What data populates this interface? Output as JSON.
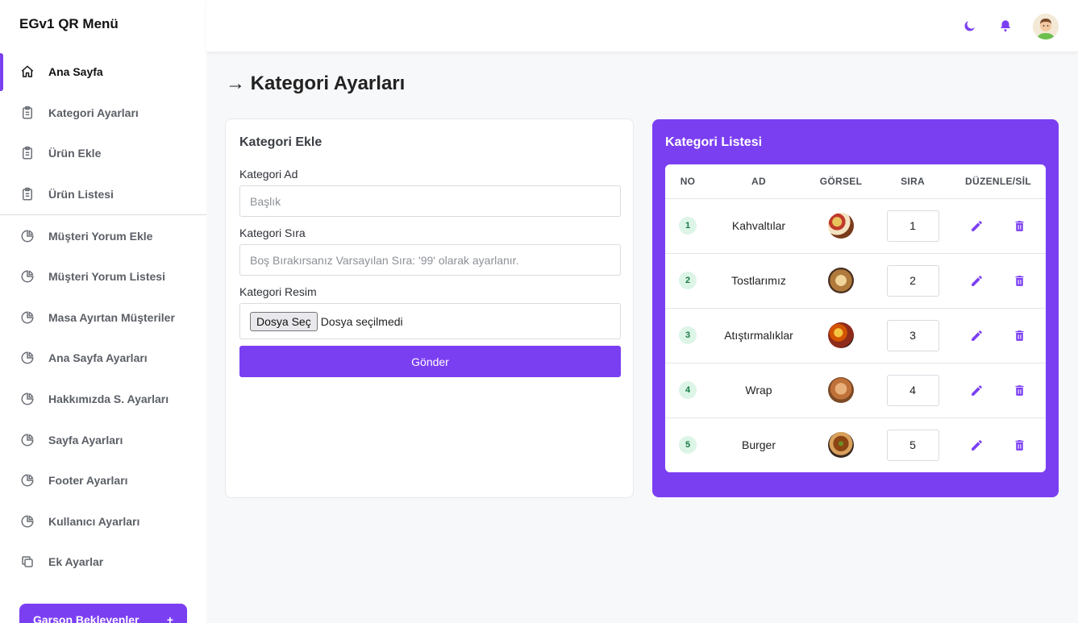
{
  "app": {
    "brand": "EGv1 QR Menü"
  },
  "sidebar": {
    "items": [
      {
        "label": "Ana Sayfa",
        "icon": "home-icon",
        "active": true
      },
      {
        "label": "Kategori Ayarları",
        "icon": "clipboard-icon"
      },
      {
        "label": "Ürün Ekle",
        "icon": "clipboard-icon"
      },
      {
        "label": "Ürün Listesi",
        "icon": "clipboard-icon"
      },
      {
        "label": "Müşteri Yorum Ekle",
        "icon": "pie-chart-icon"
      },
      {
        "label": "Müşteri Yorum Listesi",
        "icon": "pie-chart-icon"
      },
      {
        "label": "Masa Ayırtan Müşteriler",
        "icon": "pie-chart-icon"
      },
      {
        "label": "Ana Sayfa Ayarları",
        "icon": "pie-chart-icon"
      },
      {
        "label": "Hakkımızda S. Ayarları",
        "icon": "pie-chart-icon"
      },
      {
        "label": "Sayfa Ayarları",
        "icon": "pie-chart-icon"
      },
      {
        "label": "Footer Ayarları",
        "icon": "pie-chart-icon"
      },
      {
        "label": "Kullanıcı Ayarları",
        "icon": "pie-chart-icon"
      },
      {
        "label": "Ek Ayarlar",
        "icon": "copy-icon"
      }
    ],
    "waiter_button": {
      "label": "Garson Bekleyenler",
      "suffix": "+"
    }
  },
  "topbar": {
    "icons": [
      "moon-icon",
      "bell-icon",
      "avatar"
    ]
  },
  "page": {
    "title": "→ Kategori Ayarları"
  },
  "form": {
    "title": "Kategori Ekle",
    "name_label": "Kategori Ad",
    "name_placeholder": "Başlık",
    "order_label": "Kategori Sıra",
    "order_placeholder": "Boş Bırakırsanız Varsayılan Sıra: '99' olarak ayarlanır.",
    "image_label": "Kategori Resim",
    "file_button": "Dosya Seç",
    "file_status": "Dosya seçilmedi",
    "submit": "Gönder"
  },
  "list": {
    "title": "Kategori Listesi",
    "columns": [
      "NO",
      "AD",
      "GÖRSEL",
      "SIRA",
      "DÜZENLE/SİL"
    ],
    "rows": [
      {
        "no": "1",
        "name": "Kahvaltılar",
        "order": "1"
      },
      {
        "no": "2",
        "name": "Tostlarımız",
        "order": "2"
      },
      {
        "no": "3",
        "name": "Atıştırmalıklar",
        "order": "3"
      },
      {
        "no": "4",
        "name": "Wrap",
        "order": "4"
      },
      {
        "no": "5",
        "name": "Burger",
        "order": "5"
      }
    ]
  },
  "colors": {
    "accent": "#7b3ff2",
    "badge_bg": "#dcf5e7",
    "badge_text": "#1a7a45"
  }
}
